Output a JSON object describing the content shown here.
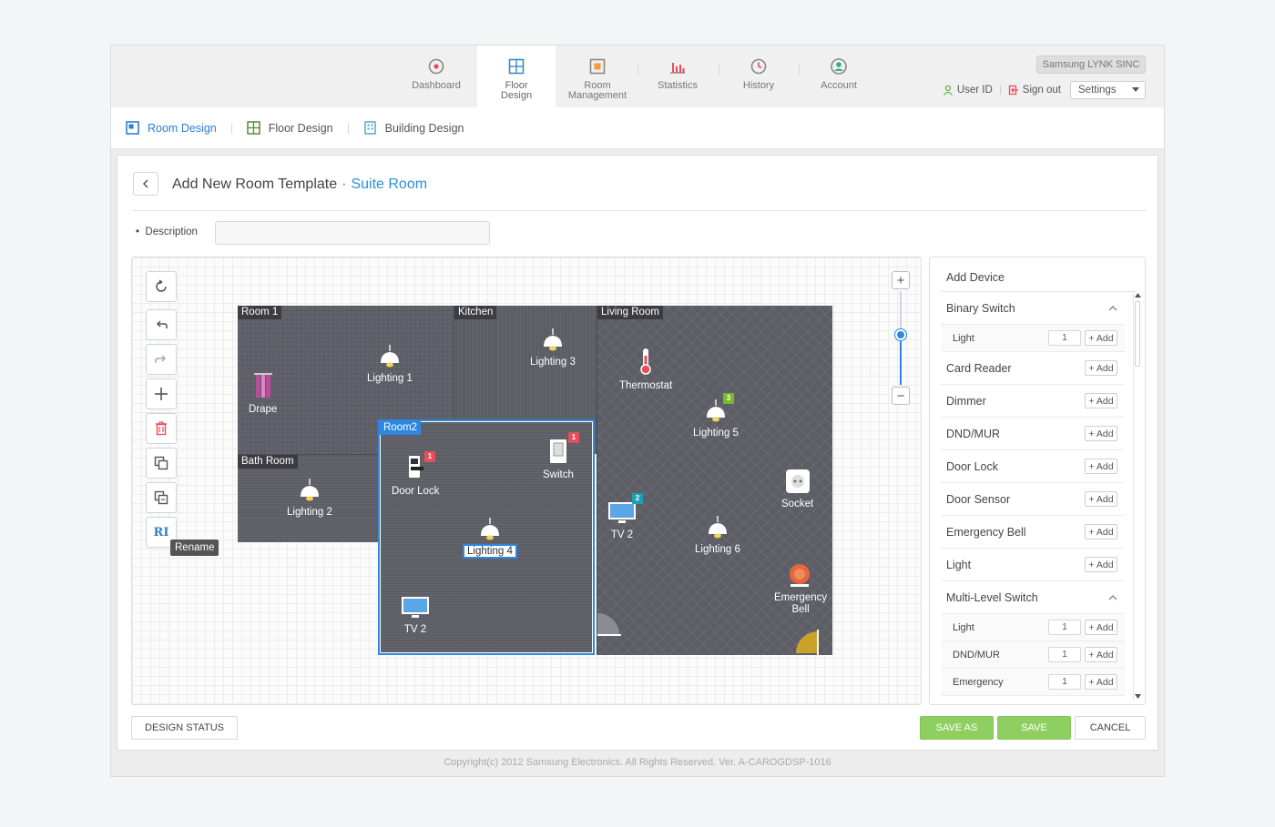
{
  "nav": {
    "items": [
      {
        "label": "Dashboard",
        "icon": "dashboard-icon"
      },
      {
        "label": "Floor\nDesign",
        "icon": "floor-design-icon"
      },
      {
        "label": "Room\nManagement",
        "icon": "room-management-icon"
      },
      {
        "label": "Statistics",
        "icon": "statistics-icon"
      },
      {
        "label": "History",
        "icon": "history-icon"
      },
      {
        "label": "Account",
        "icon": "account-icon"
      }
    ],
    "active_index": 1,
    "brand": "Samsung LYNK SINC",
    "user_id": "User ID",
    "sign_out": "Sign out",
    "settings": "Settings"
  },
  "subnav": {
    "items": [
      {
        "label": "Room Design",
        "icon": "room-design-icon",
        "active": true
      },
      {
        "label": "Floor Design",
        "icon": "floor-design-icon",
        "active": false
      },
      {
        "label": "Building Design",
        "icon": "building-design-icon",
        "active": false
      }
    ]
  },
  "page": {
    "title": "Add New Room Template",
    "separator": "·",
    "subtitle": "Suite Room",
    "description_label": "Description",
    "description_value": ""
  },
  "tools": {
    "tooltip": "Rename",
    "rename_glyph": "RI"
  },
  "rooms": [
    {
      "name": "Room 1"
    },
    {
      "name": "Kitchen"
    },
    {
      "name": "Living Room"
    },
    {
      "name": "Bath Room"
    },
    {
      "name": "Room2"
    }
  ],
  "devices": {
    "drape": "Drape",
    "lighting1": "Lighting 1",
    "lighting2": "Lighting 2",
    "lighting3": "Lighting 3",
    "lighting4": "Lighting 4",
    "lighting5": "Lighting 5",
    "lighting6": "Lighting 6",
    "thermostat": "Thermostat",
    "door_lock": "Door Lock",
    "switch": "Switch",
    "tv2_room2": "TV 2",
    "tv2_living": "TV 2",
    "socket": "Socket",
    "emergency_bell": "Emergency\nBell",
    "badge_door_lock": "1",
    "badge_switch": "1",
    "badge_lighting5": "3",
    "badge_tv2": "2"
  },
  "add_device": {
    "title": "Add Device",
    "add_label": "+ Add",
    "rows": [
      {
        "label": "Binary Switch",
        "expanded": true
      },
      {
        "label": "Light",
        "qty": "1",
        "sub": true
      },
      {
        "label": "Card Reader"
      },
      {
        "label": "Dimmer"
      },
      {
        "label": "DND/MUR"
      },
      {
        "label": "Door Lock"
      },
      {
        "label": "Door Sensor"
      },
      {
        "label": "Emergency Bell"
      },
      {
        "label": "Light"
      },
      {
        "label": "Multi-Level Switch",
        "expanded": true
      },
      {
        "label": "Light",
        "qty": "1",
        "sub": true
      },
      {
        "label": "DND/MUR",
        "qty": "1",
        "sub": true
      },
      {
        "label": "Emergency",
        "qty": "1",
        "sub": true
      }
    ]
  },
  "buttons": {
    "design_status": "DESIGN STATUS",
    "save_as": "SAVE AS",
    "save": "SAVE",
    "cancel": "CANCEL"
  },
  "footer": {
    "copyright": "Copyright(c) 2012 Samsung Electronics. All Rights Reserved. Ver. A-CAROGDSP-1016"
  },
  "colors": {
    "accent": "#2b7fd4",
    "green_button": "#8fcf62",
    "room_fill": "#5d5d66",
    "badge_red": "#e94d5b"
  }
}
